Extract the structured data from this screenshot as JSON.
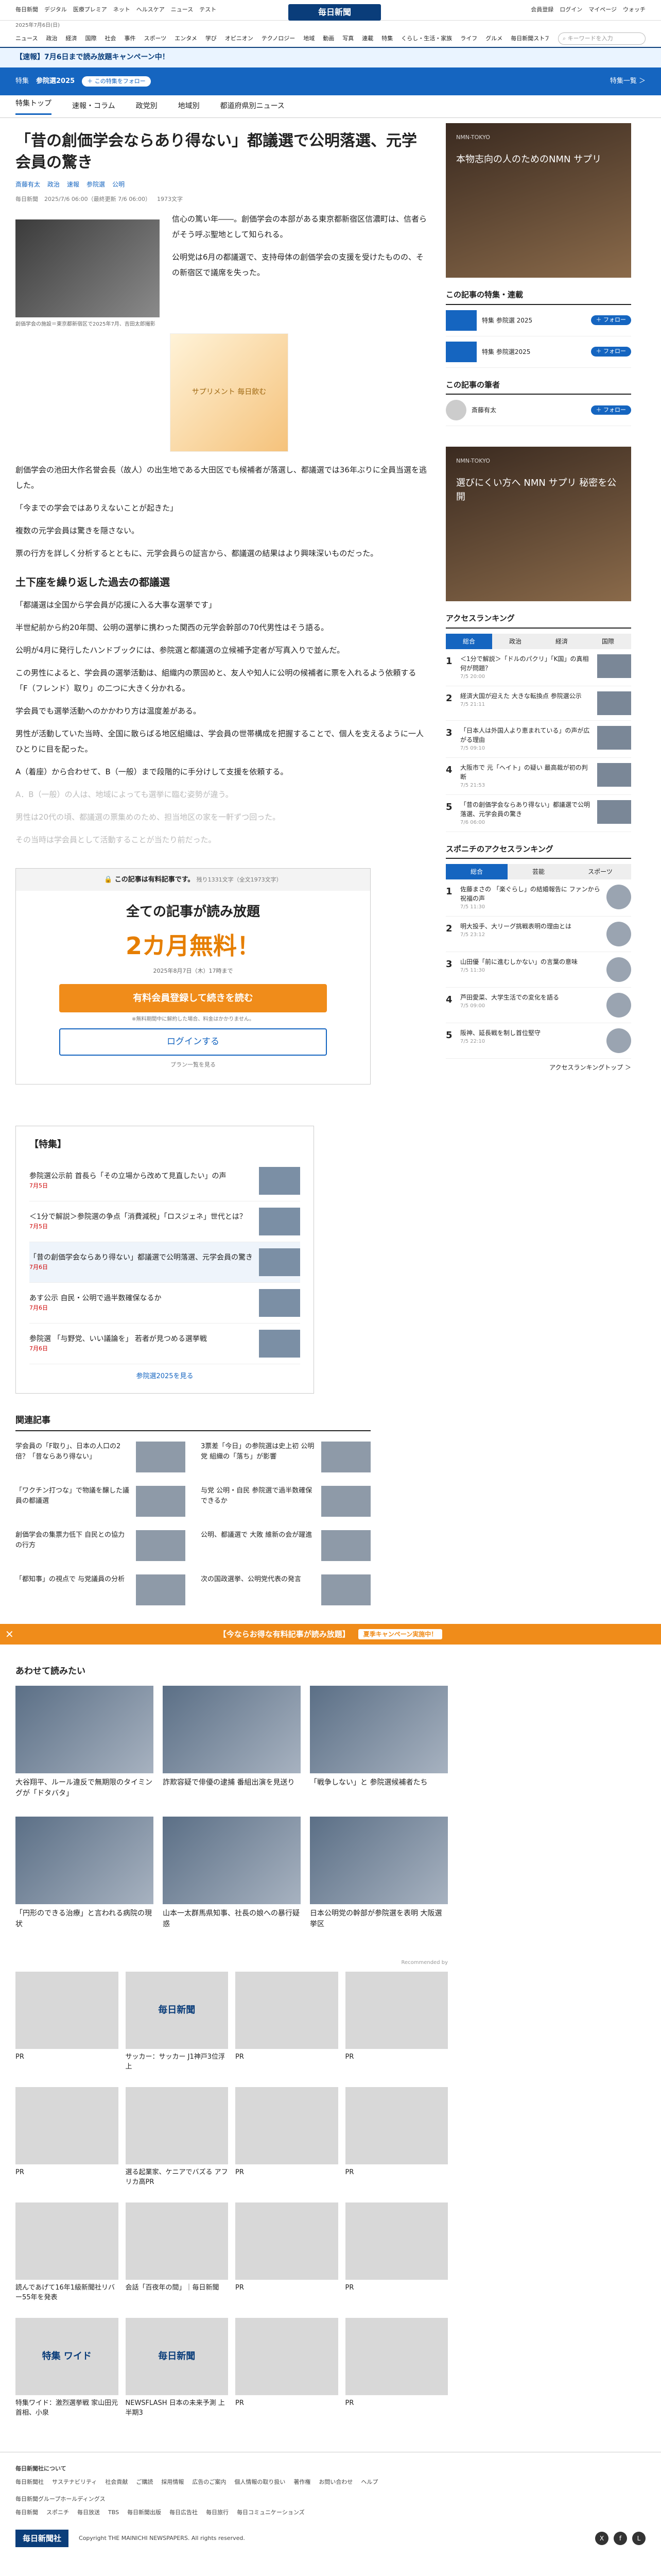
{
  "header": {
    "left_links": [
      "毎日新聞",
      "デジタル",
      "医療プレミア",
      "ネット",
      "ヘルスケア",
      "ニュース",
      "テスト"
    ],
    "logo": "毎日新聞",
    "right_links": [
      "会員登録",
      "ログイン",
      "マイページ",
      "ウォッチ"
    ],
    "date": "2025年7月6日(日)",
    "nav": [
      "ニュース",
      "政治",
      "経済",
      "国際",
      "社会",
      "事件",
      "スポーツ",
      "エンタメ",
      "学び",
      "オピニオン",
      "テクノロジー",
      "地域",
      "動画",
      "写真",
      "連載",
      "特集",
      "くらし・生活・家族",
      "ライフ",
      "グルメ",
      "毎日新聞ストア"
    ],
    "search_placeholder": "キーワードを入力"
  },
  "promo": "【速報】7月6日まで読み放題キャンペーン中！",
  "special": {
    "label": "特集",
    "title": "参院選2025",
    "follow": "＋ この特集をフォロー",
    "right": "特集一覧 ＞"
  },
  "tabs": [
    "特集トップ",
    "速報・コラム",
    "政党別",
    "地域別",
    "都道府県別ニュース"
  ],
  "article": {
    "title": "「昔の創価学会ならあり得ない」都議選で公明落選、元学会員の驚き",
    "authors": [
      "斎藤有太",
      "政治",
      "速報",
      "参院選",
      "公明"
    ],
    "meta": [
      "毎日新聞",
      "2025/7/6 06:00（最終更新 7/6 06:00）",
      "1973文字"
    ],
    "caption": "創価学会の施設＝東京都新宿区で2025年7月、吉田太郎撮影",
    "photo2_label": "サプリメント 毎日飲む",
    "paragraphs": [
      "信心の篤い年――。創価学会の本部がある東京都新宿区信濃町は、信者らがそう呼ぶ聖地として知られる。",
      "公明党は6月の都議選で、支持母体の創価学会の支援を受けたものの、その新宿区で議席を失った。",
      "創価学会の池田大作名誉会長（故人）の出生地である大田区でも候補者が落選し、都議選では36年ぶりに全員当選を逃した。",
      "「今までの学会ではありえないことが起きた」",
      "複数の元学会員は驚きを隠さない。",
      "票の行方を詳しく分析するとともに、元学会員らの証言から、都議選の結果はより興味深いものだった。"
    ],
    "h2": "土下座を繰り返した過去の都議選",
    "paragraphs2": [
      "「都議選は全国から学会員が応援に入る大事な選挙です」",
      "半世紀前から約20年間、公明の選挙に携わった関西の元学会幹部の70代男性はそう語る。",
      "公明が4月に発行したハンドブックには、参院選と都議選の立候補予定者が写真入りで並んだ。",
      "この男性によると、学会員の選挙活動は、組織内の票固めと、友人や知人に公明の候補者に票を入れるよう依頼する「F（フレンド）取り」の二つに大きく分かれる。",
      "学会員でも選挙活動へのかかわり方は温度差がある。",
      "男性が活動していた当時、全国に散らばる地区組織は、学会員の世帯構成を把握することで、個人を支えるように一人ひとりに目を配った。",
      "A（着座）から合わせて、B（一般）まで段階的に手分けして支援を依頼する。"
    ],
    "faded": [
      "A．B（一般）の人は、地域によっても選挙に臨む姿勢が違う。",
      "男性は20代の頃、都議選の票集めのため、担当地区の家を一軒ずつ回った。",
      "その当時は学会員として活動することが当たり前だった。"
    ]
  },
  "paywall": {
    "head": "この記事は有料記事です。",
    "remaining": "残り1331文字（全文1973文字）",
    "big": "全ての記事が読み放題",
    "tag": "2カ月無料！",
    "deadline": "2025年8月7日（木）17時まで",
    "cta": "有料会員登録して続きを読む",
    "note": "※無料期間中に解約した場合、料金はかかりません。",
    "login": "ログインする",
    "plan": "プラン一覧を見る"
  },
  "series": {
    "title": "【特集】",
    "items": [
      {
        "t": "参院選公示前 首長ら「その立場から改めて見直したい」の声",
        "d": "7月5日"
      },
      {
        "t": "＜1分で解説＞参院選の争点「消費減税」「ロスジェネ」世代とは？",
        "d": "7月5日"
      },
      {
        "t": "「昔の創価学会ならあり得ない」都議選で公明落選、元学会員の驚き",
        "d": "7月6日"
      },
      {
        "t": "あす公示 自民・公明で過半数確保なるか",
        "d": "7月6日"
      },
      {
        "t": "参院選 「与野党、いい議論を」 若者が見つめる選挙戦",
        "d": "7月6日"
      }
    ],
    "more": "参院選2025を見る"
  },
  "related": {
    "title": "関連記事",
    "items": [
      {
        "t": "学会員の「F取り」、日本の人口の2倍？「昔ならあり得ない」"
      },
      {
        "t": "3票差「今日」の参院選は史上初 公明党 組織の「落ち」が影響"
      },
      {
        "t": "「ワクチン打つな」で物議を醸した議員の都議選"
      },
      {
        "t": "与党 公明・自民 参院選で過半数確保できるか"
      },
      {
        "t": "創価学会の集票力低下 自民との協力の行方"
      },
      {
        "t": "公明、都議選で 大敗 維新の会が躍進"
      },
      {
        "t": "「都知事」の視点で 与党議員の分析"
      },
      {
        "t": "次の国政選挙、公明党代表の発言"
      }
    ]
  },
  "ribbon": {
    "text": "【今ならお得な有料記事が読み放題】",
    "ad": "夏季キャンペーン実施中！"
  },
  "awase": {
    "title": "あわせて読みたい",
    "items": [
      {
        "t": "大谷翔平、ルール違反で無期限のタイミングが「ドタバタ」"
      },
      {
        "t": "詐欺容疑で俳優の逮捕 番組出演を見送り"
      },
      {
        "t": "「戦争しない」と 参院選候補者たち"
      },
      {
        "t": "「円形のできる治療」と言われる病院の現状"
      },
      {
        "t": "山本一太群馬県知事、社長の娘への暴行疑惑"
      },
      {
        "t": "日本公明党の幹部が参院選を表明 大阪選挙区"
      }
    ]
  },
  "reco": {
    "label": "Recommended by",
    "items": [
      {
        "img": "",
        "t": "PR"
      },
      {
        "img": "毎日新聞",
        "t": "サッカー：サッカー J1神戸3位浮上"
      },
      {
        "img": "",
        "t": "PR"
      },
      {
        "img": "",
        "t": "PR"
      },
      {
        "img": "",
        "t": "PR"
      },
      {
        "img": "",
        "t": "選る起業家、ケニアでバズる アフリカ高PR"
      },
      {
        "img": "",
        "t": "PR"
      },
      {
        "img": "",
        "t": "PR"
      },
      {
        "img": "",
        "t": "読んであげて16年1級新聞社リバー55年を発表"
      },
      {
        "img": "",
        "t": "会話「百夜年の間」｜毎日新聞"
      },
      {
        "img": "",
        "t": "PR"
      },
      {
        "img": "",
        "t": "PR"
      },
      {
        "img": "特集 ワイド",
        "t": "特集ワイド：激烈選挙戦 家山田元首相、小泉"
      },
      {
        "img": "毎日新聞",
        "t": "NEWSFLASH 日本の未来予測 上半期3"
      },
      {
        "img": "",
        "t": "PR"
      },
      {
        "img": "",
        "t": "PR"
      }
    ]
  },
  "sidebar": {
    "ad1": "本物志向の人のためのNMN サプリ",
    "ad_brand": "NMN-TOKYO",
    "follow_head": "この記事の特集・連載",
    "follow_items": [
      "特集 参院選 2025",
      "特集 参院選2025"
    ],
    "follow_btn": "＋ フォロー",
    "writer_head": "この記事の筆者",
    "writer": "斎藤有太",
    "ad2": "選びにくい方へ NMN サプリ 秘密を公開",
    "ranking_head": "アクセスランキング",
    "rank_tabs": [
      "総合",
      "政治",
      "経済",
      "国際"
    ],
    "ranks": [
      {
        "t": "＜1分で解説＞「ドルのパクリ」「K国」の真相 何が問題？",
        "ts": "7/5 20:00"
      },
      {
        "t": "経済大国が迎えた 大きな転換点 参院選公示",
        "ts": "7/5 21:11"
      },
      {
        "t": "「日本人は外国人より恵まれている」の声が広がる理由",
        "ts": "7/5 09:10"
      },
      {
        "t": "大阪市で 元「ヘイト」の疑い 最高裁が初の判断",
        "ts": "7/5 21:53"
      },
      {
        "t": "「昔の創価学会ならあり得ない」都議選で公明落選、元学会員の驚き",
        "ts": "7/6 06:00"
      }
    ],
    "sports_head": "スポニチのアクセスランキング",
    "sports_tabs": [
      "総合",
      "芸能",
      "スポーツ"
    ],
    "sports": [
      {
        "t": "佐藤まさの 「楽ぐらし」の結婚報告に ファンから祝福の声",
        "ts": "7/5 11:30"
      },
      {
        "t": "明大投手、大リーグ挑戦表明の理由とは",
        "ts": "7/5 23:12"
      },
      {
        "t": "山田優「前に進むしかない」の言葉の意味",
        "ts": "7/5 11:30"
      },
      {
        "t": "芦田愛菜、大学生活での変化を語る",
        "ts": "7/5 09:00"
      },
      {
        "t": "阪神、延長戦を制し首位堅守",
        "ts": "7/5 22:10"
      }
    ],
    "ranking_more": "アクセスランキングトップ ＞"
  },
  "footer": {
    "head": "毎日新聞社について",
    "links": [
      "毎日新聞社",
      "サステナビリティ",
      "社会貢献",
      "ご購読",
      "採用情報",
      "広告のご案内",
      "個人情報の取り扱い",
      "著作権",
      "お問い合わせ",
      "ヘルプ"
    ],
    "group_head": "毎日新聞グループホールディングス",
    "group": [
      "毎日新聞",
      "スポニチ",
      "毎日放送",
      "TBS",
      "毎日新聞出版",
      "毎日広告社",
      "毎日旅行",
      "毎日コミュニケーションズ"
    ],
    "logo": "毎日新聞社",
    "copyright": "Copyright THE MAINICHI NEWSPAPERS. All rights reserved."
  }
}
